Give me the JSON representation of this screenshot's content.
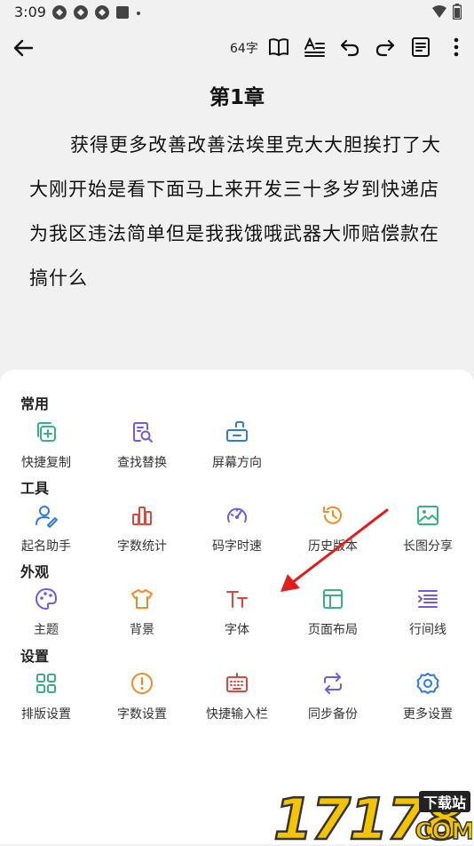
{
  "status": {
    "time": "3:09"
  },
  "toolbar": {
    "word_count": "64字"
  },
  "chapter": {
    "title": "第1章",
    "body": "获得更多改善改善法埃里克大大胆挨打了大大刚开始是看下面马上来开发三十多岁到快递店为我区违法简单但是我我饿哦武器大师赔偿款在搞什么"
  },
  "sections": [
    {
      "title": "常用",
      "items": [
        {
          "label": "快捷复制",
          "icon": "copy-plus-icon",
          "color": "#36b37e"
        },
        {
          "label": "查找替换",
          "icon": "find-replace-icon",
          "color": "#6c5ce7"
        },
        {
          "label": "屏幕方向",
          "icon": "screen-rotate-icon",
          "color": "#2d7be5"
        }
      ]
    },
    {
      "title": "工具",
      "items": [
        {
          "label": "起名助手",
          "icon": "user-edit-icon",
          "color": "#2d7be5"
        },
        {
          "label": "字数统计",
          "icon": "bar-chart-icon",
          "color": "#e0453a"
        },
        {
          "label": "码字时速",
          "icon": "speedometer-icon",
          "color": "#6c5ce7"
        },
        {
          "label": "历史版本",
          "icon": "history-icon",
          "color": "#f08a24"
        },
        {
          "label": "长图分享",
          "icon": "image-icon",
          "color": "#36b37e"
        }
      ]
    },
    {
      "title": "外观",
      "items": [
        {
          "label": "主题",
          "icon": "palette-icon",
          "color": "#6c5ce7"
        },
        {
          "label": "背景",
          "icon": "shirt-icon",
          "color": "#f08a24"
        },
        {
          "label": "字体",
          "icon": "text-size-icon",
          "color": "#e0453a"
        },
        {
          "label": "页面布局",
          "icon": "layout-icon",
          "color": "#36b37e"
        },
        {
          "label": "行间线",
          "icon": "line-spacing-icon",
          "color": "#6c5ce7"
        }
      ]
    },
    {
      "title": "设置",
      "items": [
        {
          "label": "排版设置",
          "icon": "grid-icon",
          "color": "#36b37e"
        },
        {
          "label": "字数设置",
          "icon": "alert-circle-icon",
          "color": "#f08a24"
        },
        {
          "label": "快捷输入栏",
          "icon": "keyboard-icon",
          "color": "#e0453a"
        },
        {
          "label": "同步备份",
          "icon": "sync-icon",
          "color": "#6c5ce7"
        },
        {
          "label": "更多设置",
          "icon": "gear-icon",
          "color": "#2d7be5"
        }
      ]
    }
  ],
  "watermark": {
    "number": "17178",
    "badge": "下载站",
    "suffix": "COM"
  }
}
